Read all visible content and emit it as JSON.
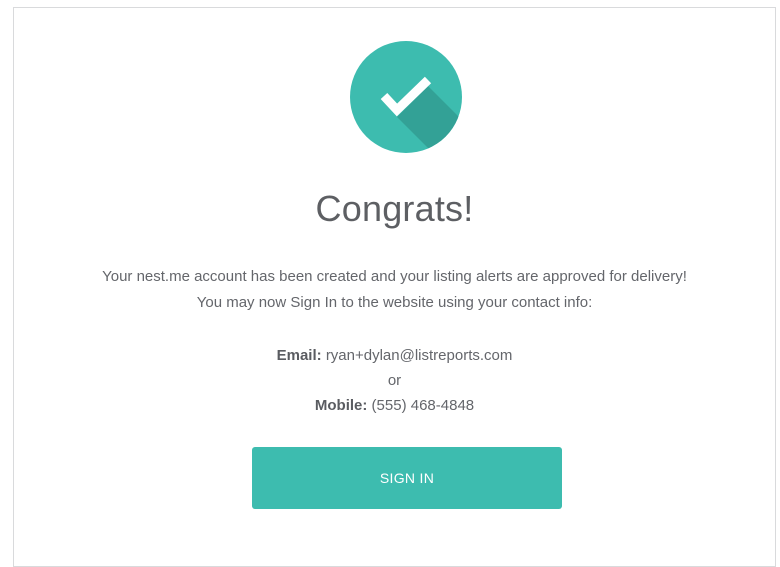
{
  "title": "Congrats!",
  "message": {
    "line1": "Your nest.me account has been created and your listing alerts are approved for delivery!",
    "line2": "You may now Sign In to the website using your contact info:"
  },
  "contact": {
    "email_label": "Email:",
    "email_value": "ryan+dylan@listreports.com",
    "or_text": "or",
    "mobile_label": "Mobile:",
    "mobile_value": "(555) 468-4848"
  },
  "sign_in_label": "SIGN IN",
  "icons": {
    "success": "checkmark-icon"
  },
  "colors": {
    "accent": "#3dbcaf",
    "accent_shadow": "#33a196",
    "text": "#64666b",
    "border": "#d9dadc"
  }
}
